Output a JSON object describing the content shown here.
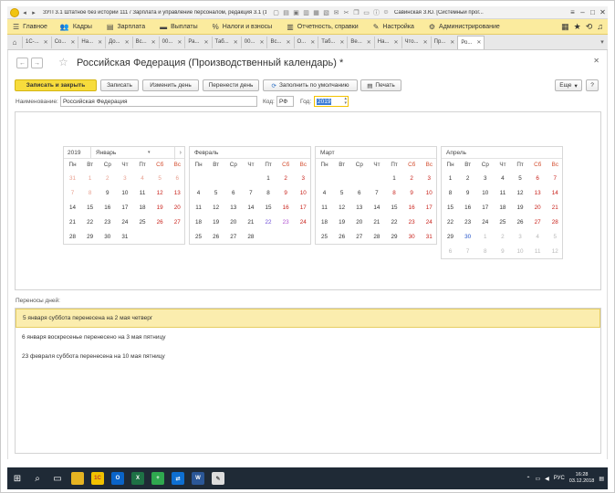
{
  "titlebar": {
    "title": "ЗУП 3.1 Штатное без истории 111 / Зарплата и управление персоналом, редакция 3.1 (1С:Предприятие)",
    "user": "Савинская З.Ю. [Системный прог..."
  },
  "menu": {
    "items": [
      {
        "label": "Главное",
        "icon": "menu-lines-icon"
      },
      {
        "label": "Кадры",
        "icon": "people-icon"
      },
      {
        "label": "Зарплата",
        "icon": "list-icon"
      },
      {
        "label": "Выплаты",
        "icon": "money-icon"
      },
      {
        "label": "Налоги и взносы",
        "icon": "percent-icon"
      },
      {
        "label": "Отчетность, справки",
        "icon": "report-icon"
      },
      {
        "label": "Настройка",
        "icon": "wrench-icon"
      },
      {
        "label": "Администрирование",
        "icon": "gear-icon"
      }
    ]
  },
  "tabs": [
    "1С-...",
    "Со...",
    "На...",
    "До...",
    "Вс...",
    "00...",
    "Ра...",
    "Таб...",
    "00...",
    "Вс...",
    "О...",
    "Таб...",
    "Ве...",
    "На...",
    "Чтo...",
    "Пр...",
    "Ро..."
  ],
  "form": {
    "title": "Российская Федерация (Производственный календарь) *",
    "buttons": {
      "save_close": "Записать и закрыть",
      "save": "Записать",
      "change_day": "Изменить день",
      "move_day": "Перенести день",
      "fill_default": "Заполнить по умолчанию",
      "print": "Печать",
      "more": "Еще",
      "help": "?"
    },
    "name_label": "Наименование:",
    "name_value": "Российская Федерация",
    "code_label": "Код:",
    "code_value": "РФ",
    "year_label": "Год:",
    "year_value": "2019"
  },
  "calendar": {
    "year": "2019",
    "weekdays": [
      "Пн",
      "Вт",
      "Ср",
      "Чт",
      "Пт",
      "Сб",
      "Вс"
    ],
    "months": [
      {
        "name": "Январь",
        "days": [
          [
            "31",
            "o w"
          ],
          [
            "1",
            "o w"
          ],
          [
            "2",
            "o w"
          ],
          [
            "3",
            "o w"
          ],
          [
            "4",
            "o w"
          ],
          [
            "5",
            "o w"
          ],
          [
            "6",
            "o w"
          ],
          [
            "7",
            "o w"
          ],
          [
            "8",
            "o w"
          ],
          [
            "9",
            ""
          ],
          [
            "10",
            ""
          ],
          [
            "11",
            ""
          ],
          [
            "12",
            "w"
          ],
          [
            "13",
            "w"
          ],
          [
            "14",
            ""
          ],
          [
            "15",
            ""
          ],
          [
            "16",
            ""
          ],
          [
            "17",
            ""
          ],
          [
            "18",
            ""
          ],
          [
            "19",
            "w"
          ],
          [
            "20",
            "w"
          ],
          [
            "21",
            ""
          ],
          [
            "22",
            ""
          ],
          [
            "23",
            ""
          ],
          [
            "24",
            ""
          ],
          [
            "25",
            ""
          ],
          [
            "26",
            "w"
          ],
          [
            "27",
            "w"
          ],
          [
            "28",
            ""
          ],
          [
            "29",
            ""
          ],
          [
            "30",
            ""
          ],
          [
            "31",
            ""
          ],
          [
            "",
            ""
          ],
          [
            "",
            ""
          ],
          [
            "",
            ""
          ]
        ]
      },
      {
        "name": "Февраль",
        "days": [
          [
            "",
            ""
          ],
          [
            "",
            ""
          ],
          [
            "",
            ""
          ],
          [
            "",
            ""
          ],
          [
            "1",
            ""
          ],
          [
            "2",
            "w"
          ],
          [
            "3",
            "w"
          ],
          [
            "4",
            ""
          ],
          [
            "5",
            ""
          ],
          [
            "6",
            ""
          ],
          [
            "7",
            ""
          ],
          [
            "8",
            ""
          ],
          [
            "9",
            "w"
          ],
          [
            "10",
            "w"
          ],
          [
            "11",
            ""
          ],
          [
            "12",
            ""
          ],
          [
            "13",
            ""
          ],
          [
            "14",
            ""
          ],
          [
            "15",
            ""
          ],
          [
            "16",
            "w"
          ],
          [
            "17",
            "w"
          ],
          [
            "18",
            ""
          ],
          [
            "19",
            ""
          ],
          [
            "20",
            ""
          ],
          [
            "21",
            ""
          ],
          [
            "22",
            "pre"
          ],
          [
            "23",
            "purp"
          ],
          [
            "24",
            "w"
          ],
          [
            "25",
            ""
          ],
          [
            "26",
            ""
          ],
          [
            "27",
            ""
          ],
          [
            "28",
            ""
          ],
          [
            "",
            ""
          ],
          [
            "",
            ""
          ],
          [
            "",
            ""
          ]
        ]
      },
      {
        "name": "Март",
        "days": [
          [
            "",
            ""
          ],
          [
            "",
            ""
          ],
          [
            "",
            ""
          ],
          [
            "",
            ""
          ],
          [
            "1",
            ""
          ],
          [
            "2",
            "w"
          ],
          [
            "3",
            "w"
          ],
          [
            "4",
            ""
          ],
          [
            "5",
            ""
          ],
          [
            "6",
            ""
          ],
          [
            "7",
            ""
          ],
          [
            "8",
            "w"
          ],
          [
            "9",
            "w"
          ],
          [
            "10",
            "w"
          ],
          [
            "11",
            ""
          ],
          [
            "12",
            ""
          ],
          [
            "13",
            ""
          ],
          [
            "14",
            ""
          ],
          [
            "15",
            ""
          ],
          [
            "16",
            "w"
          ],
          [
            "17",
            "w"
          ],
          [
            "18",
            ""
          ],
          [
            "19",
            ""
          ],
          [
            "20",
            ""
          ],
          [
            "21",
            ""
          ],
          [
            "22",
            ""
          ],
          [
            "23",
            "w"
          ],
          [
            "24",
            "w"
          ],
          [
            "25",
            ""
          ],
          [
            "26",
            ""
          ],
          [
            "27",
            ""
          ],
          [
            "28",
            ""
          ],
          [
            "29",
            ""
          ],
          [
            "30",
            "w"
          ],
          [
            "31",
            "w"
          ]
        ]
      },
      {
        "name": "Апрель",
        "days": [
          [
            "1",
            ""
          ],
          [
            "2",
            ""
          ],
          [
            "3",
            ""
          ],
          [
            "4",
            ""
          ],
          [
            "5",
            ""
          ],
          [
            "6",
            "w"
          ],
          [
            "7",
            "w"
          ],
          [
            "8",
            ""
          ],
          [
            "9",
            ""
          ],
          [
            "10",
            ""
          ],
          [
            "11",
            ""
          ],
          [
            "12",
            ""
          ],
          [
            "13",
            "w"
          ],
          [
            "14",
            "w"
          ],
          [
            "15",
            ""
          ],
          [
            "16",
            ""
          ],
          [
            "17",
            ""
          ],
          [
            "18",
            ""
          ],
          [
            "19",
            ""
          ],
          [
            "20",
            "w"
          ],
          [
            "21",
            "w"
          ],
          [
            "22",
            ""
          ],
          [
            "23",
            ""
          ],
          [
            "24",
            ""
          ],
          [
            "25",
            ""
          ],
          [
            "26",
            ""
          ],
          [
            "27",
            "w"
          ],
          [
            "28",
            "w"
          ],
          [
            "29",
            ""
          ],
          [
            "30",
            "blue"
          ],
          [
            "1",
            "o"
          ],
          [
            "2",
            "o"
          ],
          [
            "3",
            "o"
          ],
          [
            "4",
            "o"
          ],
          [
            "5",
            "o"
          ],
          [
            "6",
            "o"
          ],
          [
            "7",
            "o"
          ],
          [
            "8",
            "o"
          ],
          [
            "9",
            "o"
          ],
          [
            "10",
            "o"
          ],
          [
            "11",
            "o"
          ],
          [
            "12",
            "o"
          ]
        ]
      }
    ]
  },
  "transfers": {
    "label": "Переносы дней:",
    "items": [
      "5 января суббота перенесена на 2 мая четверг",
      "6 января воскресенье перенесено на 3 мая пятницу",
      "23 февраля суббота перенесена на 10 мая пятницу"
    ]
  },
  "taskbar": {
    "lang": "РУС",
    "time": "16:28",
    "date": "03.12.2018"
  },
  "colors": {
    "menu_bg": "#fbeb9e",
    "primary_button": "#f7dc3c",
    "weekend": "#c8211a",
    "selection": "#fbedae"
  }
}
